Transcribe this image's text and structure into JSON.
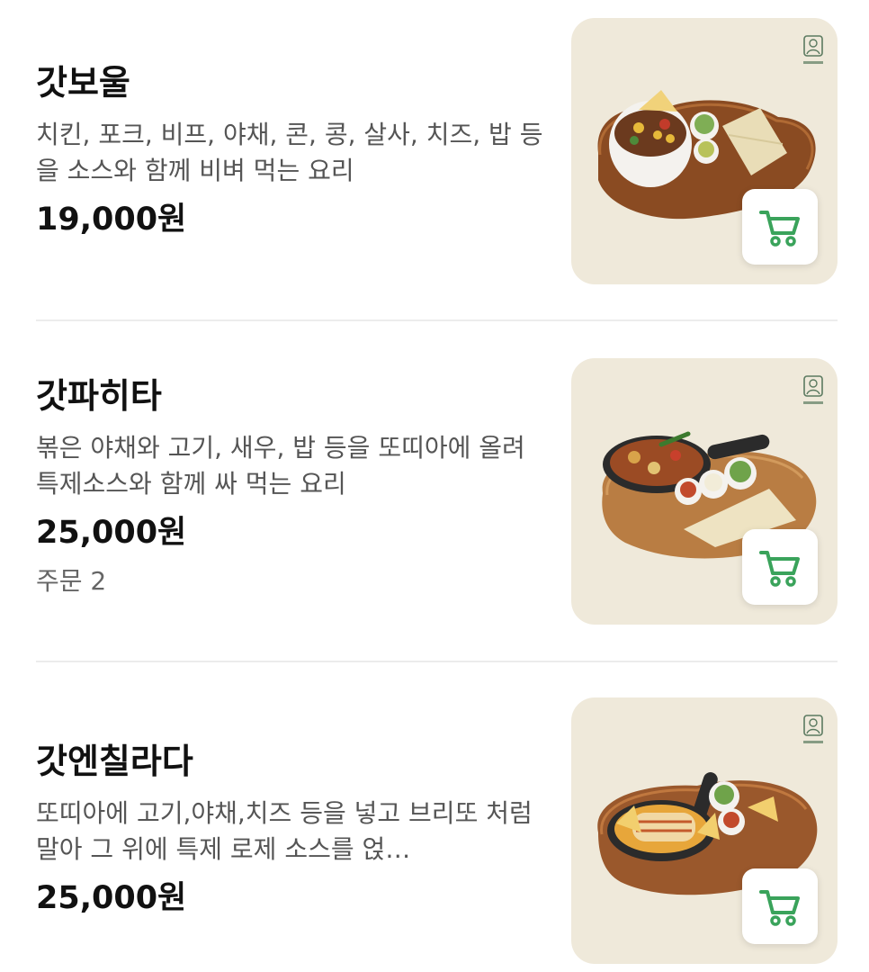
{
  "colors": {
    "accent_green": "#3aa35b",
    "thumb_bg": "#efe9da",
    "text_primary": "#111111",
    "text_secondary": "#555555"
  },
  "menu": {
    "items": [
      {
        "name": "갓보울",
        "description": "치킨, 포크, 비프, 야채, 콘, 콩, 살사, 치즈, 밥 등을 소스와 함께 비벼 먹는 요리",
        "price": "19,000원",
        "cart_icon": "cart-icon",
        "logo_icon": "brand-logo-icon"
      },
      {
        "name": "갓파히타",
        "description": "볶은 야채와 고기, 새우, 밥 등을 또띠아에 올려 특제소스와 함께 싸 먹는 요리",
        "price": "25,000원",
        "orders": "주문 2",
        "cart_icon": "cart-icon",
        "logo_icon": "brand-logo-icon"
      },
      {
        "name": "갓엔칠라다",
        "description": "또띠아에 고기,야채,치즈 등을 넣고 브리또 처럼 말아 그 위에 특제 로제 소스를 얹…",
        "price": "25,000원",
        "cart_icon": "cart-icon",
        "logo_icon": "brand-logo-icon"
      }
    ]
  }
}
